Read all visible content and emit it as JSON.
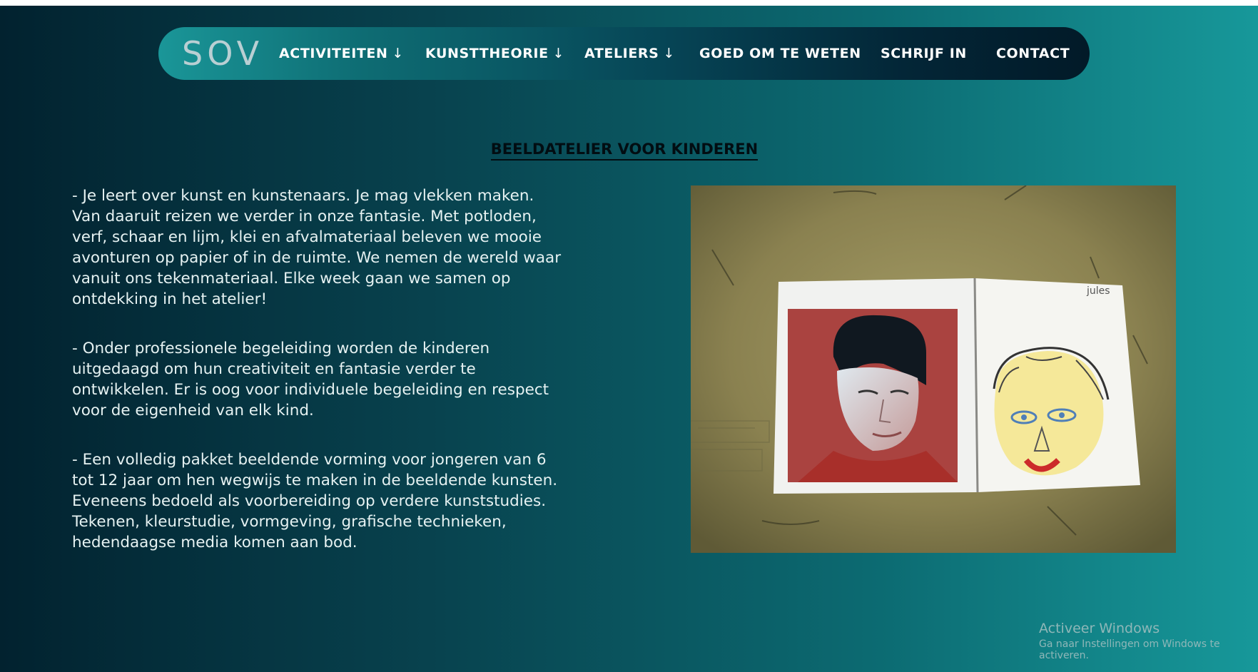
{
  "nav": {
    "logo": "SOV",
    "items": [
      {
        "label": "ACTIVITEITEN",
        "arrow": "↓"
      },
      {
        "label": "KUNSTTHEORIE",
        "arrow": "↓"
      },
      {
        "label": "ATELIERS",
        "arrow": "↓"
      },
      {
        "label": "GOED OM TE WETEN",
        "arrow": ""
      },
      {
        "label": "SCHRIJF IN",
        "arrow": ""
      },
      {
        "label": "CONTACT",
        "arrow": ""
      }
    ]
  },
  "main": {
    "title": "BEELDATELIER VOOR KINDEREN",
    "paragraphs": [
      "- Je leert over kunst en kunstenaars. Je mag vlekken maken. Van daaruit reizen we verder in onze fantasie. Met potloden, verf, schaar en lijm, klei en afvalmateriaal beleven we mooie avonturen op papier of in de ruimte. We nemen de wereld waar vanuit ons tekenmateriaal. Elke week gaan we samen op ontdekking in het atelier!",
      "- Onder professionele begeleiding worden de kinderen uitgedaagd om hun creativiteit en fantasie verder te ontwikkelen. Er is oog voor individuele begeleiding en respect voor de eigenheid van elk kind.",
      "- Een volledig pakket beeldende vorming voor jongeren van 6 tot 12 jaar om hen wegwijs te maken in de beeldende kunsten. Eveneens bedoeld als voorbereiding op verdere kunststudies. Tekenen, kleurstudie, vormgeving, grafische technieken, hedendaagse media komen aan bod."
    ],
    "photo_signature": "jules"
  },
  "watermark": {
    "title": "Activeer Windows",
    "subtitle": "Ga naar Instellingen om Windows te activeren."
  },
  "colors": {
    "background_left": "#02222f",
    "background_right": "#17989a",
    "nav_text": "#ffffff",
    "body_text": "#e6f2f2",
    "heading_text": "#020d12"
  }
}
